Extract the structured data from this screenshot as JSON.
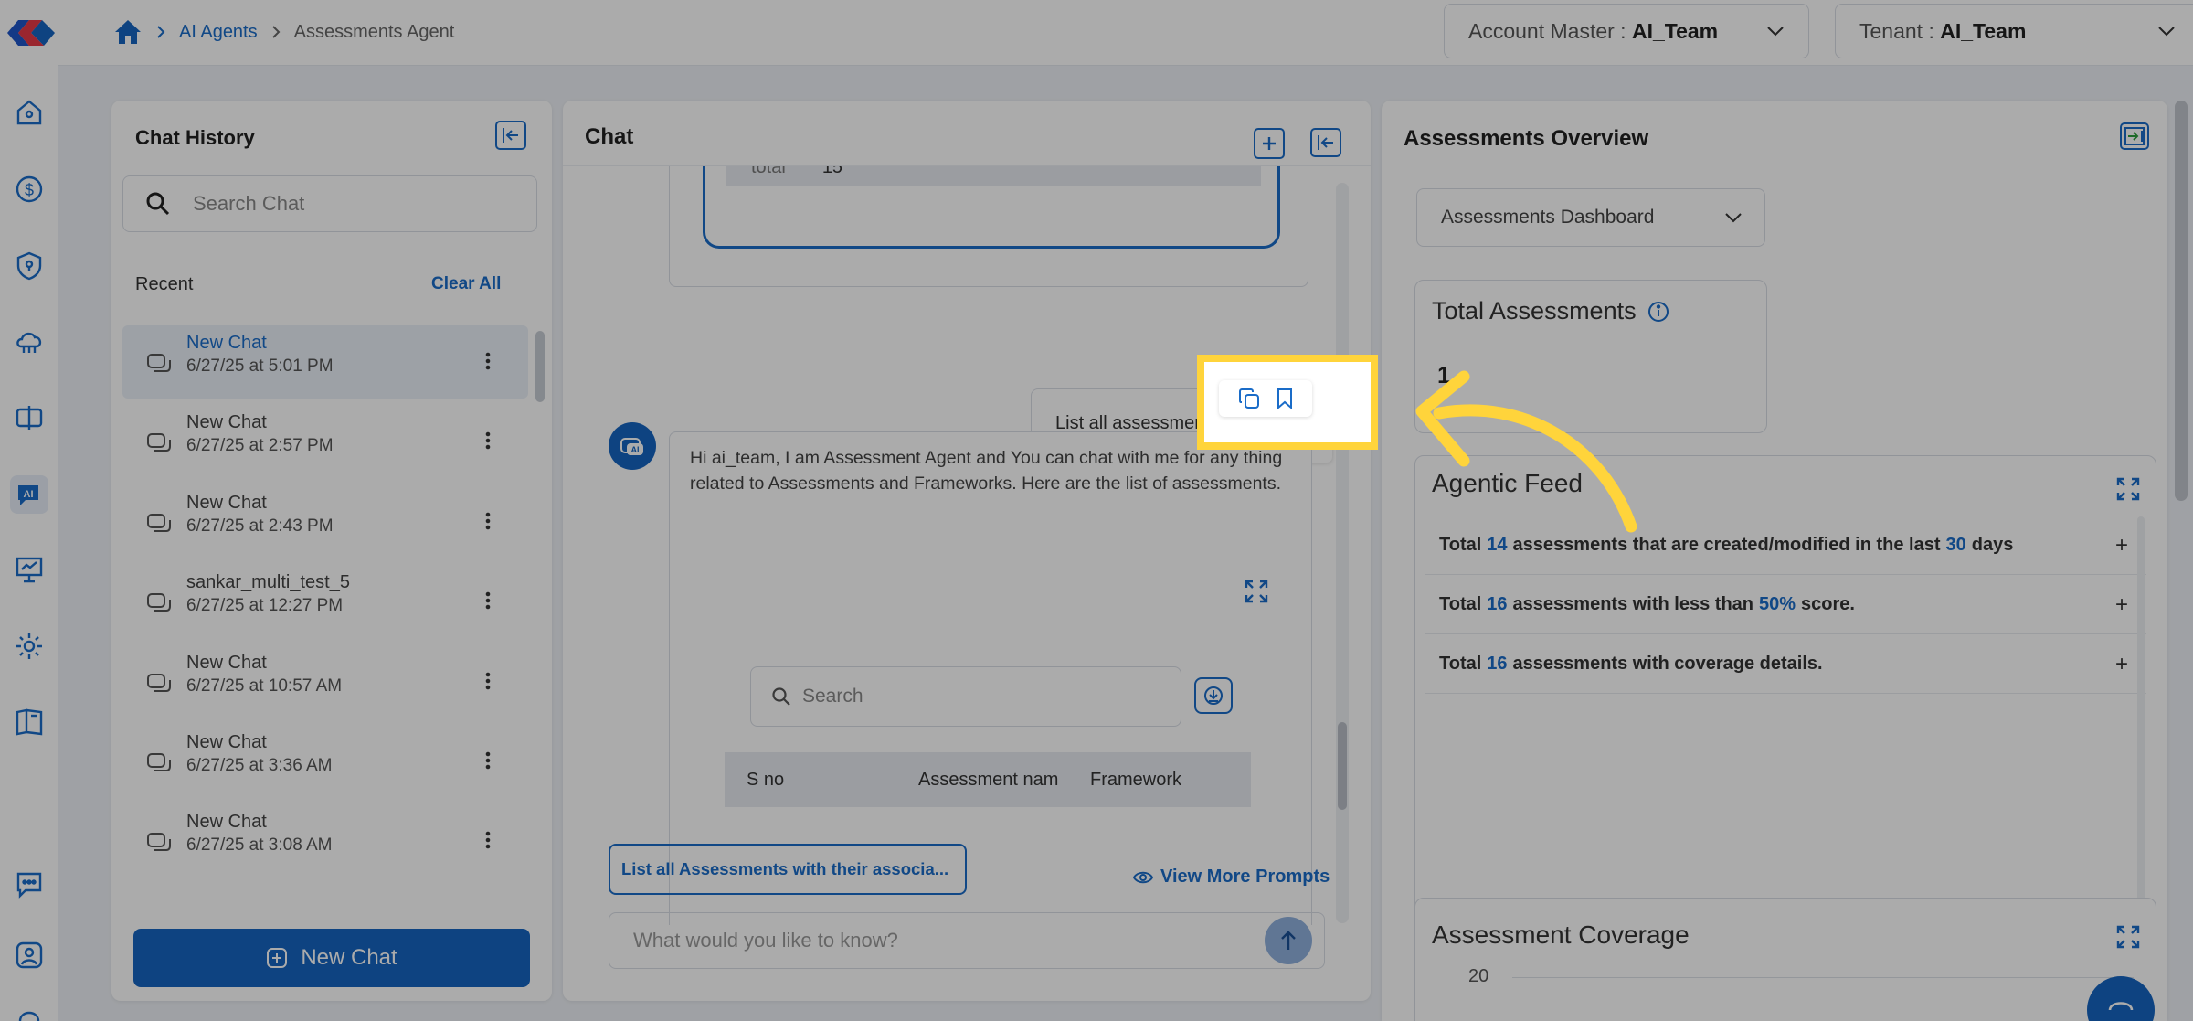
{
  "breadcrumb": {
    "ai_agents": "AI Agents",
    "current": "Assessments Agent"
  },
  "header": {
    "account_master_label": "Account Master :",
    "account_master_value": "AI_Team",
    "tenant_label": "Tenant :",
    "tenant_value": "AI_Team"
  },
  "history": {
    "title": "Chat History",
    "search_placeholder": "Search Chat",
    "recent_label": "Recent",
    "clear_all": "Clear All",
    "items": [
      {
        "name": "New Chat",
        "time": "6/27/25 at 5:01 PM"
      },
      {
        "name": "New Chat",
        "time": "6/27/25 at 2:57 PM"
      },
      {
        "name": "New Chat",
        "time": "6/27/25 at 2:43 PM"
      },
      {
        "name": "sankar_multi_test_5",
        "time": "6/27/25 at 12:27 PM"
      },
      {
        "name": "New Chat",
        "time": "6/27/25 at 10:57 AM"
      },
      {
        "name": "New Chat",
        "time": "6/27/25 at 3:36 AM"
      },
      {
        "name": "New Chat",
        "time": "6/27/25 at 3:08 AM"
      }
    ],
    "new_chat": "New Chat"
  },
  "chat": {
    "title": "Chat",
    "prev_table_label": "total",
    "prev_table_value": "15",
    "user_message": "List all assessments",
    "agent_message": "Hi ai_team, I am Assessment Agent and You can chat with me for any thing related to Assessments and Frameworks. Here are the list of assessments.",
    "table_search_placeholder": "Search",
    "table_headers": [
      "S no",
      "Assessment nam",
      "Framework"
    ],
    "suggestion": "List all Assessments with their associa...",
    "view_more": "View More Prompts",
    "input_placeholder": "What would you like to know?"
  },
  "overview": {
    "title": "Assessments Overview",
    "dashboard_select": "Assessments Dashboard",
    "total_title": "Total Assessments",
    "total_value": "1",
    "feed_title": "Agentic Feed",
    "feed": [
      {
        "pre": "Total",
        "n1": "14",
        "mid": "assessments that are created/modified in the last",
        "n2": "30",
        "post": "days"
      },
      {
        "pre": "Total",
        "n1": "16",
        "mid": "assessments with less than",
        "n2": "50%",
        "post": "score."
      },
      {
        "pre": "Total",
        "n1": "16",
        "mid": "assessments with coverage details.",
        "n2": "",
        "post": ""
      }
    ],
    "coverage_title": "Assessment Coverage",
    "coverage_tick": "20"
  },
  "colors": {
    "accent": "#1a6cc8",
    "highlight": "#ffd43b",
    "avatar_user": "#8e2b4e"
  }
}
